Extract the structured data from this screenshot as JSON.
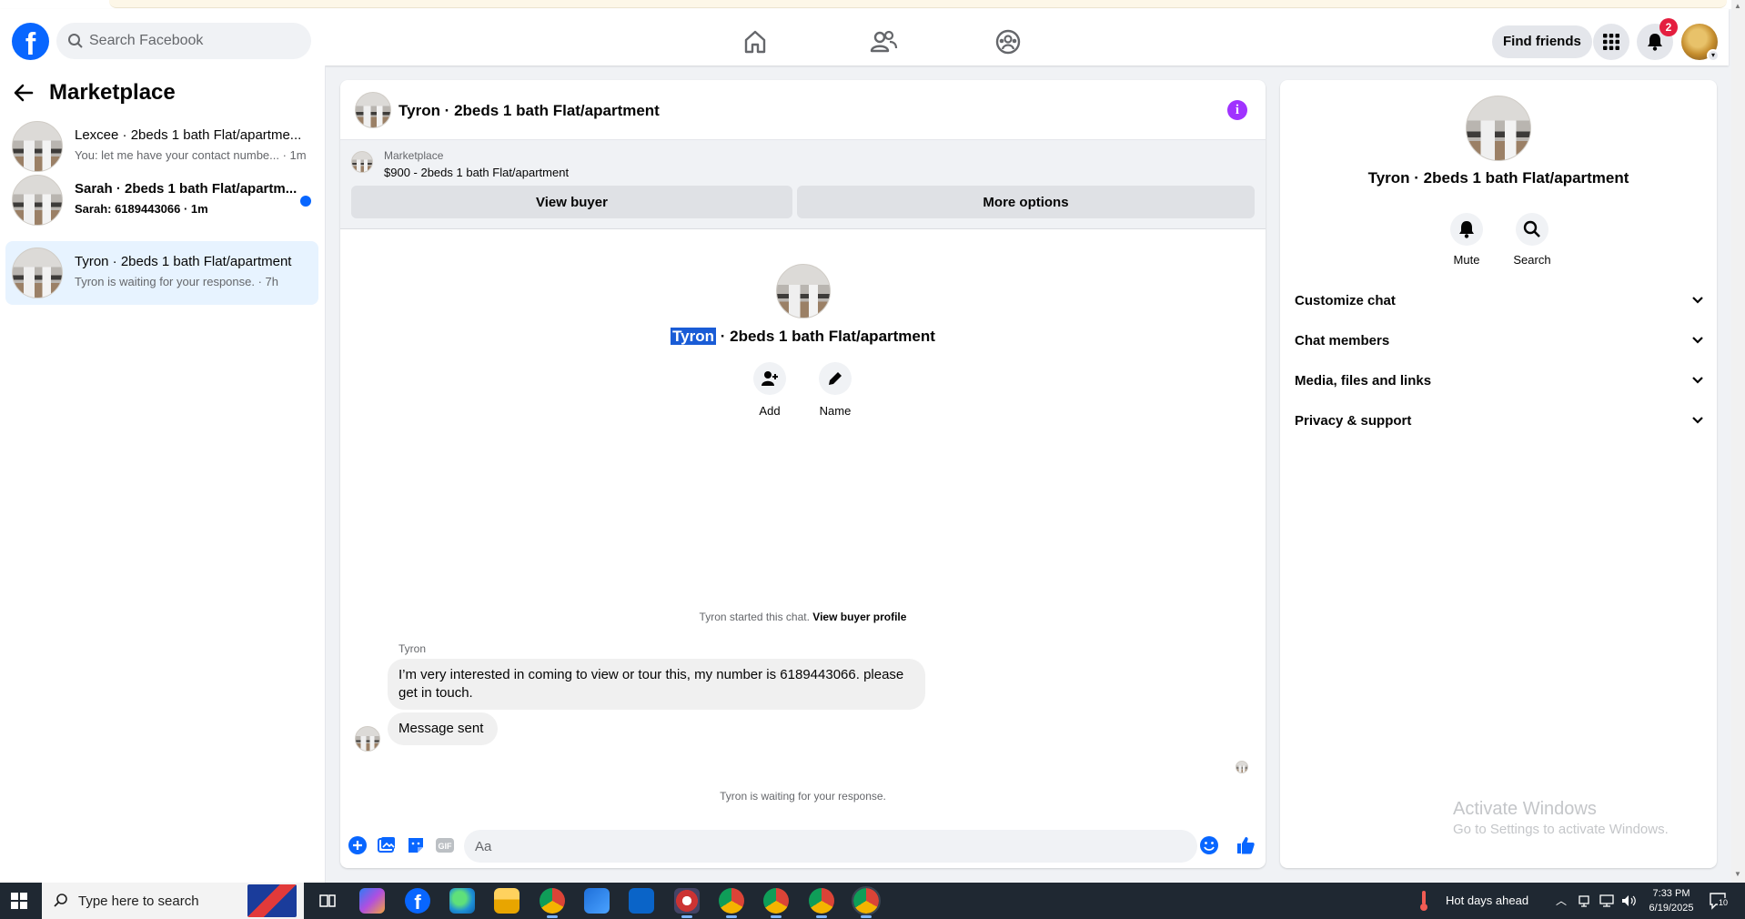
{
  "header": {
    "search_placeholder": "Search Facebook",
    "find_friends_label": "Find friends",
    "notification_count": "2",
    "brand_color": "#0866ff"
  },
  "sidebar": {
    "title": "Marketplace",
    "conversations": [
      {
        "name": "Lexcee · 2beds 1 bath Flat/apartme...",
        "snippet": "You: let me have your contact numbe... · 1m",
        "unread": false,
        "active": false
      },
      {
        "name": "Sarah · 2beds 1 bath Flat/apartm...",
        "snippet": "Sarah: 6189443066 · 1m",
        "unread": true,
        "active": false
      },
      {
        "name": "Tyron · 2beds 1 bath Flat/apartment",
        "snippet": "Tyron is waiting for your response. · 7h",
        "unread": false,
        "active": true
      }
    ]
  },
  "chat": {
    "title": "Tyron · 2beds 1 bath Flat/apartment",
    "listing": {
      "source": "Marketplace",
      "price_title": "$900 - 2beds 1 bath Flat/apartment"
    },
    "view_buyer_label": "View buyer",
    "more_options_label": "More options",
    "profile": {
      "name_highlight": "Tyron",
      "name_rest": " · 2beds 1 bath Flat/apartment",
      "add_label": "Add",
      "name_label": "Name"
    },
    "started_text": "Tyron started this chat.",
    "view_buyer_profile": "View buyer profile",
    "sender": "Tyron",
    "messages": [
      "I’m very interested in coming to view or tour this, my number is 6189443066. please get in touch.",
      "Message sent"
    ],
    "waiting_text": "Tyron is waiting for your response.",
    "composer_placeholder": "Aa",
    "gif_label": "GIF"
  },
  "info_panel": {
    "title": "Tyron · 2beds 1 bath Flat/apartment",
    "mute_label": "Mute",
    "search_label": "Search",
    "sections": [
      "Customize chat",
      "Chat members",
      "Media, files and links",
      "Privacy & support"
    ],
    "watermark_title": "Activate Windows",
    "watermark_sub": "Go to Settings to activate Windows."
  },
  "taskbar": {
    "search_placeholder": "Type here to search",
    "weather": "Hot days ahead",
    "time": "7:33 PM",
    "date": "6/19/2025",
    "notification_count": "10"
  }
}
